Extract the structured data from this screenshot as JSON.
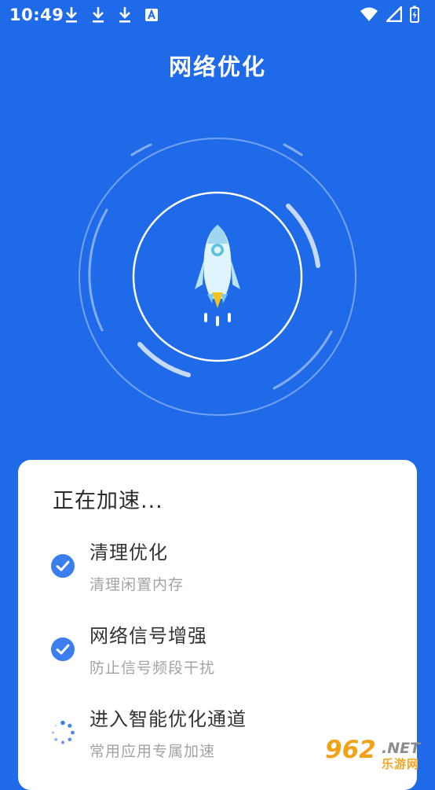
{
  "status_bar": {
    "time": "10:49",
    "notification_icons": [
      "download-icon",
      "download-icon",
      "download-icon",
      "text-a-icon"
    ],
    "system_icons": [
      "wifi-icon",
      "signal-icon",
      "battery-charging-icon"
    ]
  },
  "header": {
    "title": "网络优化"
  },
  "illustration": {
    "icon": "rocket-icon"
  },
  "card": {
    "title": "正在加速...",
    "tasks": [
      {
        "title": "清理优化",
        "subtitle": "清理闲置内存",
        "status": "done",
        "icon": "check-circle-icon"
      },
      {
        "title": "网络信号增强",
        "subtitle": "防止信号频段干扰",
        "status": "done",
        "icon": "check-circle-icon"
      },
      {
        "title": "进入智能优化通道",
        "subtitle": "常用应用专属加速",
        "status": "loading",
        "icon": "spinner-icon"
      }
    ]
  },
  "watermark": {
    "number": "962",
    "domain": ".NET",
    "name": "乐游网"
  },
  "colors": {
    "primary": "#1f6ae8",
    "accent": "#2f7ef0",
    "card": "#ffffff",
    "watermark": "#f4a11a"
  }
}
